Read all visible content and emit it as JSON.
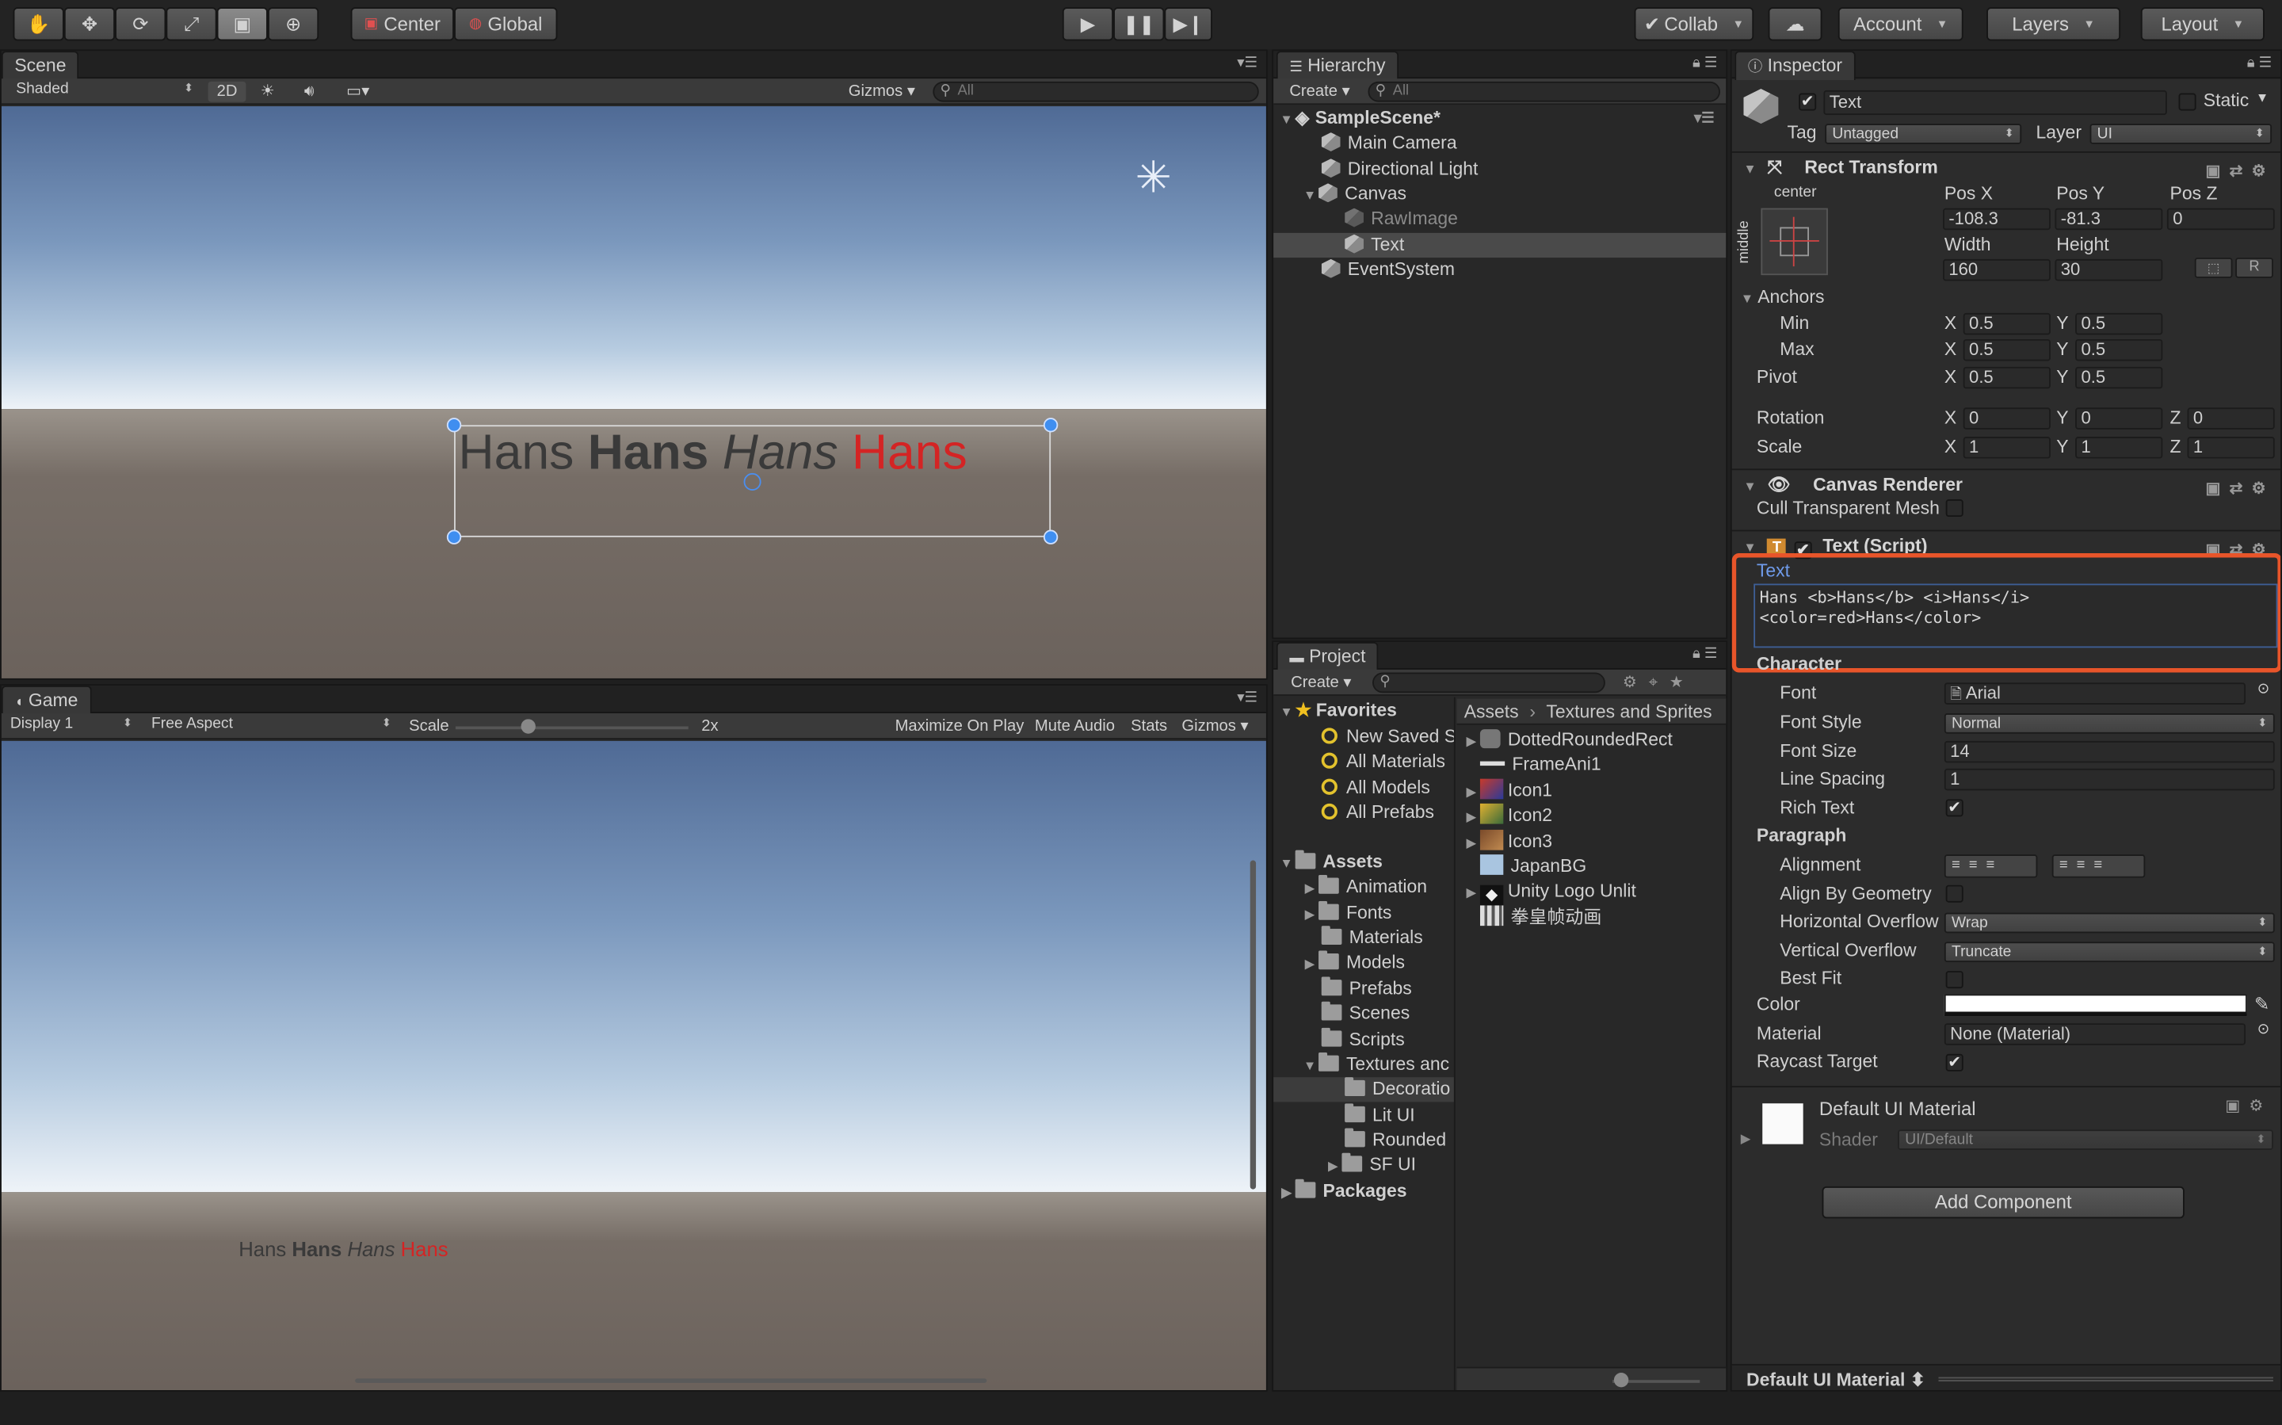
{
  "toolbar": {
    "pivot_center": "Center",
    "pivot_global": "Global",
    "collab": "Collab",
    "account": "Account",
    "layers": "Layers",
    "layout": "Layout"
  },
  "scene": {
    "tab": "Scene",
    "shading": "Shaded",
    "mode_2d": "2D",
    "gizmos": "Gizmos",
    "search_placeholder": "All",
    "text_words": [
      "Hans",
      "Hans",
      "Hans",
      "Hans"
    ]
  },
  "game": {
    "tab": "Game",
    "display": "Display 1",
    "aspect": "Free Aspect",
    "scale_label": "Scale",
    "scale_value": "2x",
    "scale_fraction": 0.3,
    "maximize": "Maximize On Play",
    "mute": "Mute Audio",
    "stats": "Stats",
    "gizmos": "Gizmos",
    "text_words": [
      "Hans",
      "Hans",
      "Hans",
      "Hans"
    ]
  },
  "hierarchy": {
    "tab": "Hierarchy",
    "create": "Create",
    "search_placeholder": "All",
    "scene_name": "SampleScene*",
    "items": [
      "Main Camera",
      "Directional Light",
      "Canvas",
      "RawImage",
      "Text",
      "EventSystem"
    ]
  },
  "project": {
    "tab": "Project",
    "create": "Create",
    "favorites_label": "Favorites",
    "favorites": [
      "New Saved S",
      "All Materials",
      "All Models",
      "All Prefabs"
    ],
    "assets_label": "Assets",
    "folders": [
      "Animation",
      "Fonts",
      "Materials",
      "Models",
      "Prefabs",
      "Scenes",
      "Scripts",
      "Textures anc",
      "Decoratio",
      "Lit UI",
      "Rounded",
      "SF UI"
    ],
    "packages_label": "Packages",
    "breadcrumb": [
      "Assets",
      "Textures and Sprites"
    ],
    "files": [
      "DottedRoundedRect",
      "FrameAni1",
      "Icon1",
      "Icon2",
      "Icon3",
      "JapanBG",
      "Unity Logo Unlit",
      "拳皇帧动画"
    ]
  },
  "inspector": {
    "tab": "Inspector",
    "object_name": "Text",
    "static_label": "Static",
    "tag_label": "Tag",
    "tag_value": "Untagged",
    "layer_label": "Layer",
    "layer_value": "UI",
    "rect_transform": {
      "title": "Rect Transform",
      "anchor_h": "center",
      "anchor_v": "middle",
      "pos_x_label": "Pos X",
      "pos_y_label": "Pos Y",
      "pos_z_label": "Pos Z",
      "pos_x": "-108.3",
      "pos_y": "-81.3",
      "pos_z": "0",
      "width_label": "Width",
      "height_label": "Height",
      "width": "160",
      "height": "30",
      "r_button": "R",
      "anchors_label": "Anchors",
      "min_label": "Min",
      "max_label": "Max",
      "min_x": "0.5",
      "min_y": "0.5",
      "max_x": "0.5",
      "max_y": "0.5",
      "pivot_label": "Pivot",
      "pivot_x": "0.5",
      "pivot_y": "0.5",
      "rotation_label": "Rotation",
      "rot_x": "0",
      "rot_y": "0",
      "rot_z": "0",
      "scale_label": "Scale",
      "scale_x": "1",
      "scale_y": "1",
      "scale_z": "1",
      "x": "X",
      "y": "Y",
      "z": "Z"
    },
    "canvas_renderer": {
      "title": "Canvas Renderer",
      "cull_label": "Cull Transparent Mesh"
    },
    "text_script": {
      "title": "Text (Script)",
      "text_label": "Text",
      "text_line1": "Hans <b>Hans</b> <i>Hans</i>",
      "text_line2": "<color=red>Hans</color>",
      "character_label": "Character",
      "font_label": "Font",
      "font_value": "Arial",
      "font_style_label": "Font Style",
      "font_style_value": "Normal",
      "font_size_label": "Font Size",
      "font_size_value": "14",
      "line_spacing_label": "Line Spacing",
      "line_spacing_value": "1",
      "rich_text_label": "Rich Text",
      "paragraph_label": "Paragraph",
      "alignment_label": "Alignment",
      "align_geom_label": "Align By Geometry",
      "h_overflow_label": "Horizontal Overflow",
      "h_overflow_value": "Wrap",
      "v_overflow_label": "Vertical Overflow",
      "v_overflow_value": "Truncate",
      "best_fit_label": "Best Fit",
      "color_label": "Color",
      "material_label": "Material",
      "material_value": "None (Material)",
      "raycast_label": "Raycast Target"
    },
    "material": {
      "name": "Default UI Material",
      "shader_label": "Shader",
      "shader_value": "UI/Default"
    },
    "add_component": "Add Component",
    "footer_label": "Default UI Material"
  },
  "colors": {
    "highlight_box": "#e8552a",
    "rich_red": "#d42424",
    "selection": "#3e5f96",
    "handle": "#3f8ef0"
  }
}
